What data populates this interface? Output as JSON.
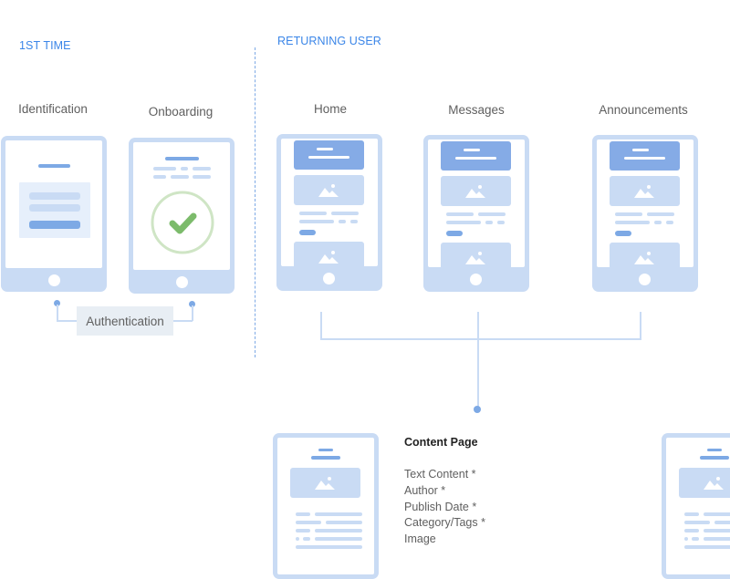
{
  "sections": {
    "first_time": "1ST TIME",
    "returning_user": "RETURNING USER"
  },
  "screens": {
    "identification": "Identification",
    "onboarding": "Onboarding",
    "home": "Home",
    "messages": "Messages",
    "announcements": "Announcements"
  },
  "connector": {
    "authentication": "Authentication"
  },
  "content_page": {
    "title": "Content Page",
    "fields": [
      "Text Content *",
      "Author *",
      "Publish Date *",
      "Category/Tags *",
      "Image"
    ]
  },
  "icons": {
    "check": "check-icon",
    "image": "image-placeholder-icon"
  },
  "colors": {
    "accent": "#3b86e8",
    "frame": "#c9dbf4",
    "primary_block": "#7da9e5",
    "success": "#7cbb6b"
  }
}
